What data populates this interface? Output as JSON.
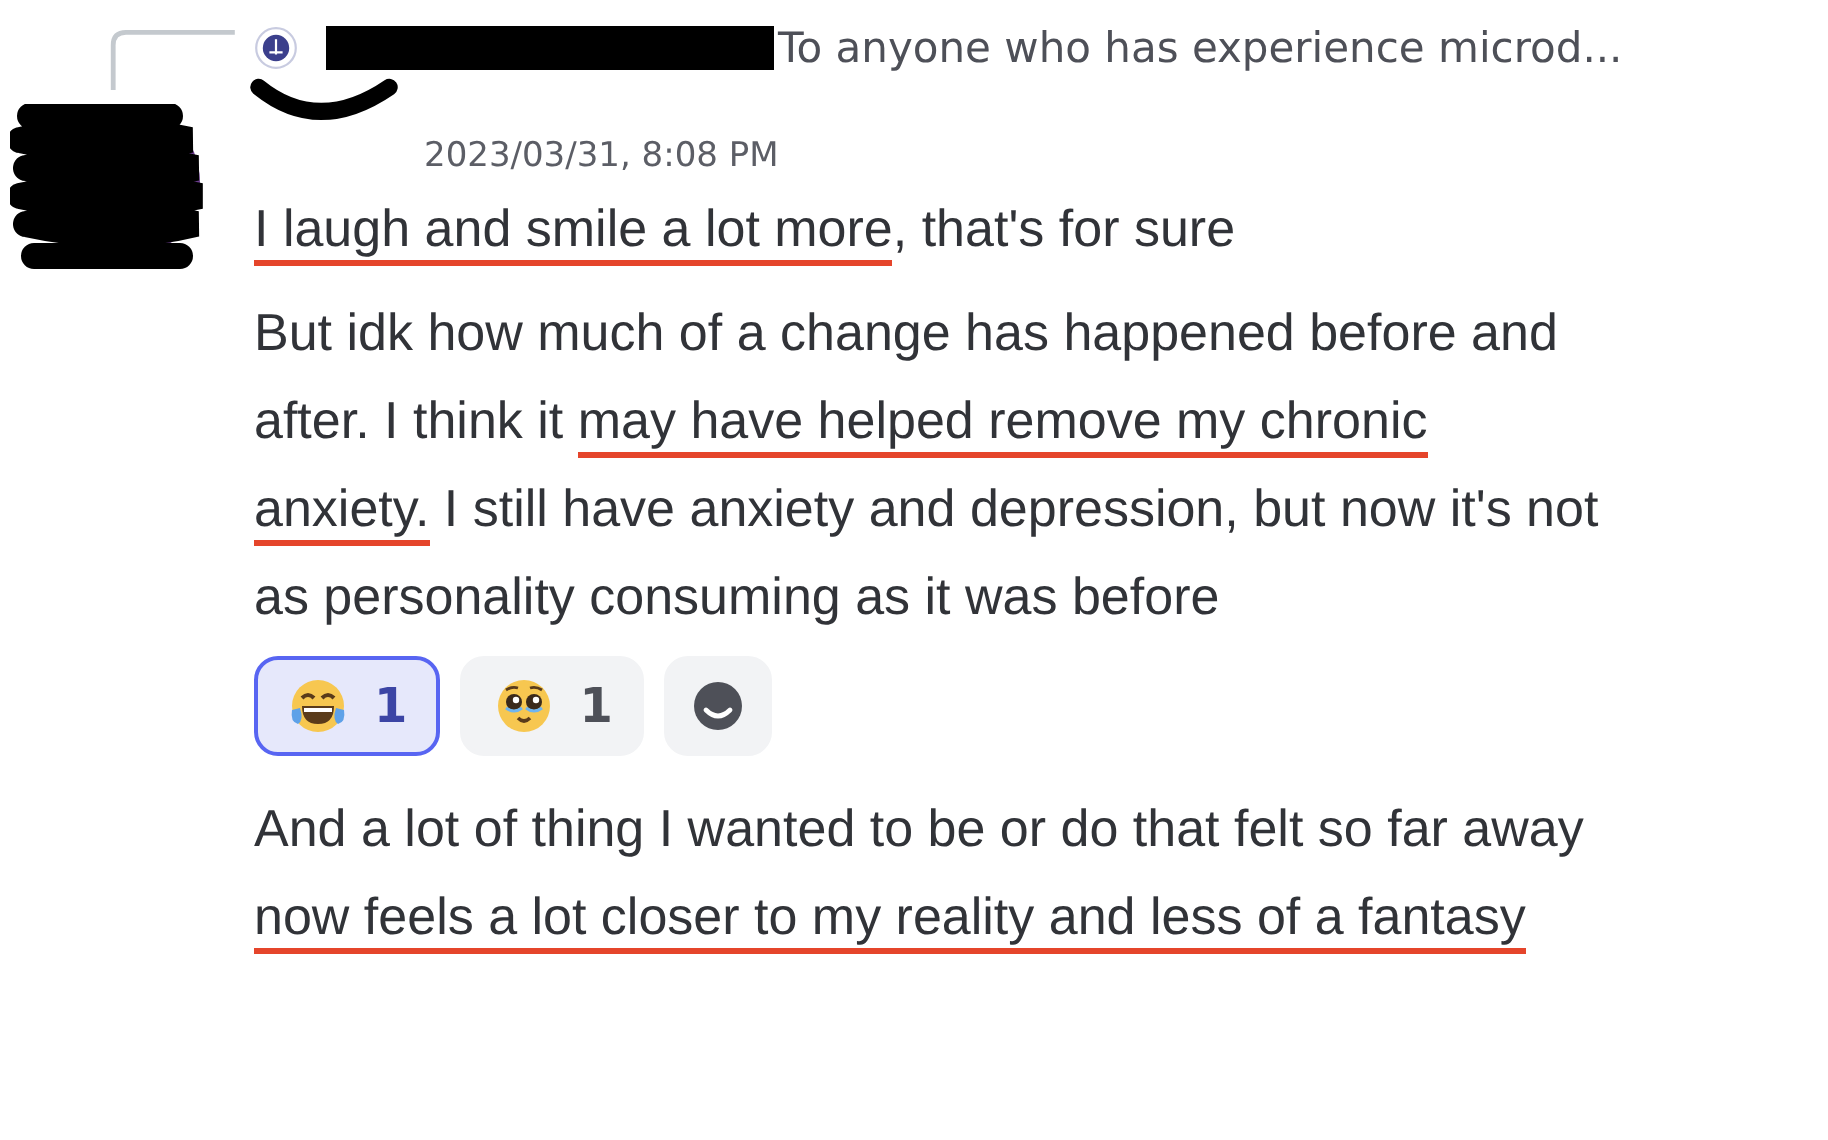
{
  "reply": {
    "preview": "To anyone who has experience microd..."
  },
  "message": {
    "timestamp": "2023/03/31, 8:08 PM",
    "paragraphs": [
      [
        {
          "text": "I laugh and smile a lot more",
          "underlined": true
        },
        {
          "text": ", that's for sure",
          "underlined": false
        }
      ],
      [
        {
          "text": "But idk how much of a change has happened before and after. I think it ",
          "underlined": false
        },
        {
          "text": "may have helped remove my chronic anxiety.",
          "underlined": true
        },
        {
          "text": " I still have anxiety and depression, but now it's not as personality consuming as it was before",
          "underlined": false
        }
      ]
    ],
    "reactions": [
      {
        "kind": "laughing",
        "count": "1",
        "selected": true
      },
      {
        "kind": "pleading",
        "count": "1",
        "selected": false
      }
    ],
    "paragraphs_after": [
      [
        {
          "text": "And a lot of thing I wanted to be or do that felt so far away ",
          "underlined": false
        },
        {
          "text": "now feels a lot closer to my reality and less of a fantasy",
          "underlined": true
        }
      ]
    ]
  }
}
